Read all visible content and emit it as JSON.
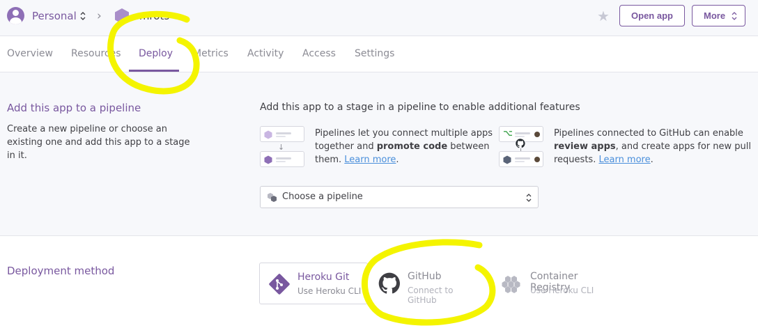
{
  "colors": {
    "accent": "#79589f",
    "link": "#4a8fdb",
    "annotation": "#f4f400"
  },
  "header": {
    "account": "Personal",
    "separator": "›",
    "app_name": "smrots",
    "open_app_label": "Open app",
    "more_label": "More"
  },
  "tabs": [
    {
      "label": "Overview"
    },
    {
      "label": "Resources"
    },
    {
      "label": "Deploy"
    },
    {
      "label": "Metrics"
    },
    {
      "label": "Activity"
    },
    {
      "label": "Access"
    },
    {
      "label": "Settings"
    }
  ],
  "active_tab": "Deploy",
  "pipeline": {
    "title": "Add this app to a pipeline",
    "description_lines": [
      "Create a new pipeline or choose an",
      "existing one and add this app to a stage",
      "in it."
    ],
    "heading": "Add this app to a stage in a pipeline to enable additional features",
    "feature1": {
      "line1": "Pipelines let you connect multiple apps",
      "line2_pre": "together and ",
      "line2_bold": "promote code",
      "line2_post": " between",
      "line3_pre": "them. ",
      "link": "Learn more",
      "line3_post": "."
    },
    "feature2": {
      "line1": "Pipelines connected to GitHub can enable",
      "line2_bold": "review apps",
      "line2_post": ", and create apps for new pull",
      "line3_pre": "requests. ",
      "link": "Learn more",
      "line3_post": "."
    },
    "select_placeholder": "Choose a pipeline"
  },
  "deployment": {
    "title": "Deployment method",
    "methods": [
      {
        "title": "Heroku Git",
        "subtitle": "Use Heroku CLI",
        "icon": "git-icon"
      },
      {
        "title": "GitHub",
        "subtitle": "Connect to GitHub",
        "icon": "github-icon"
      },
      {
        "title": "Container Registry",
        "subtitle": "Use Heroku CLI",
        "icon": "container-registry-icon"
      }
    ]
  }
}
